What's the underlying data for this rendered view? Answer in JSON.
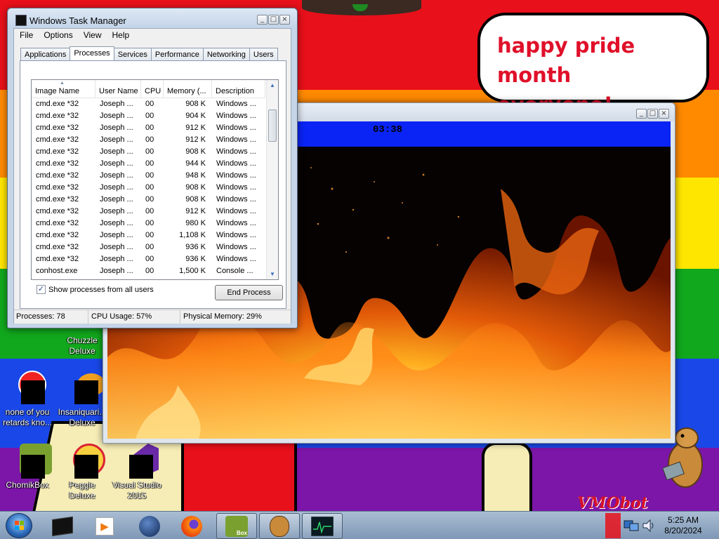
{
  "bubble": {
    "line1": "happy pride month",
    "line2": "everyone!"
  },
  "desktop_icons": [
    {
      "label": "Chuzzle Deluxe",
      "icon": "chuzzle-icon"
    },
    {
      "label": "none of you retards kno...",
      "icon": "red-app-icon"
    },
    {
      "label": "Insaniquari... Deluxe",
      "icon": "insaniquarium-icon"
    },
    {
      "label": "ChomikBox",
      "icon": "chomikbox-icon"
    },
    {
      "label": "Peggle Deluxe",
      "icon": "peggle-icon"
    },
    {
      "label": "Visual Studio 2015",
      "icon": "visual-studio-icon"
    }
  ],
  "fire_window": {
    "timer": "03:38"
  },
  "task_manager": {
    "title": "Windows Task Manager",
    "menu": [
      "File",
      "Options",
      "View",
      "Help"
    ],
    "tabs": [
      "Applications",
      "Processes",
      "Services",
      "Performance",
      "Networking",
      "Users"
    ],
    "active_tab": "Processes",
    "columns": [
      "Image Name",
      "User Name",
      "CPU",
      "Memory (...",
      "Description"
    ],
    "rows": [
      [
        "cmd.exe *32",
        "Joseph ...",
        "00",
        "908 K",
        "Windows ..."
      ],
      [
        "cmd.exe *32",
        "Joseph ...",
        "00",
        "904 K",
        "Windows ..."
      ],
      [
        "cmd.exe *32",
        "Joseph ...",
        "00",
        "912 K",
        "Windows ..."
      ],
      [
        "cmd.exe *32",
        "Joseph ...",
        "00",
        "912 K",
        "Windows ..."
      ],
      [
        "cmd.exe *32",
        "Joseph ...",
        "00",
        "908 K",
        "Windows ..."
      ],
      [
        "cmd.exe *32",
        "Joseph ...",
        "00",
        "944 K",
        "Windows ..."
      ],
      [
        "cmd.exe *32",
        "Joseph ...",
        "00",
        "948 K",
        "Windows ..."
      ],
      [
        "cmd.exe *32",
        "Joseph ...",
        "00",
        "908 K",
        "Windows ..."
      ],
      [
        "cmd.exe *32",
        "Joseph ...",
        "00",
        "908 K",
        "Windows ..."
      ],
      [
        "cmd.exe *32",
        "Joseph ...",
        "00",
        "912 K",
        "Windows ..."
      ],
      [
        "cmd.exe *32",
        "Joseph ...",
        "00",
        "980 K",
        "Windows ..."
      ],
      [
        "cmd.exe *32",
        "Joseph ...",
        "00",
        "1,108 K",
        "Windows ..."
      ],
      [
        "cmd.exe *32",
        "Joseph ...",
        "00",
        "936 K",
        "Windows ..."
      ],
      [
        "cmd.exe *32",
        "Joseph ...",
        "00",
        "936 K",
        "Windows ..."
      ],
      [
        "conhost.exe",
        "Joseph ...",
        "00",
        "1,500 K",
        "Console ..."
      ]
    ],
    "show_all_label": "Show processes from all users",
    "show_all_checked": true,
    "end_process_label": "End Process",
    "status": {
      "processes": "Processes: 78",
      "cpu": "CPU Usage: 57%",
      "memory": "Physical Memory: 29%"
    }
  },
  "taskbar": {
    "items": [
      "terminal-icon",
      "media-player-icon",
      "globe-icon",
      "firefox-icon",
      "chomikbox-icon",
      "hamster-icon",
      "task-manager-icon"
    ],
    "clock_time": "5:25 AM",
    "clock_date": "8/20/2024"
  },
  "colors": {
    "stripes": [
      "#e8101a",
      "#ff8a00",
      "#ffe600",
      "#11a81d",
      "#1a48e8",
      "#7b16a8"
    ],
    "bubble_text": "#e0102a",
    "timer_bar": "#0a24f5"
  }
}
